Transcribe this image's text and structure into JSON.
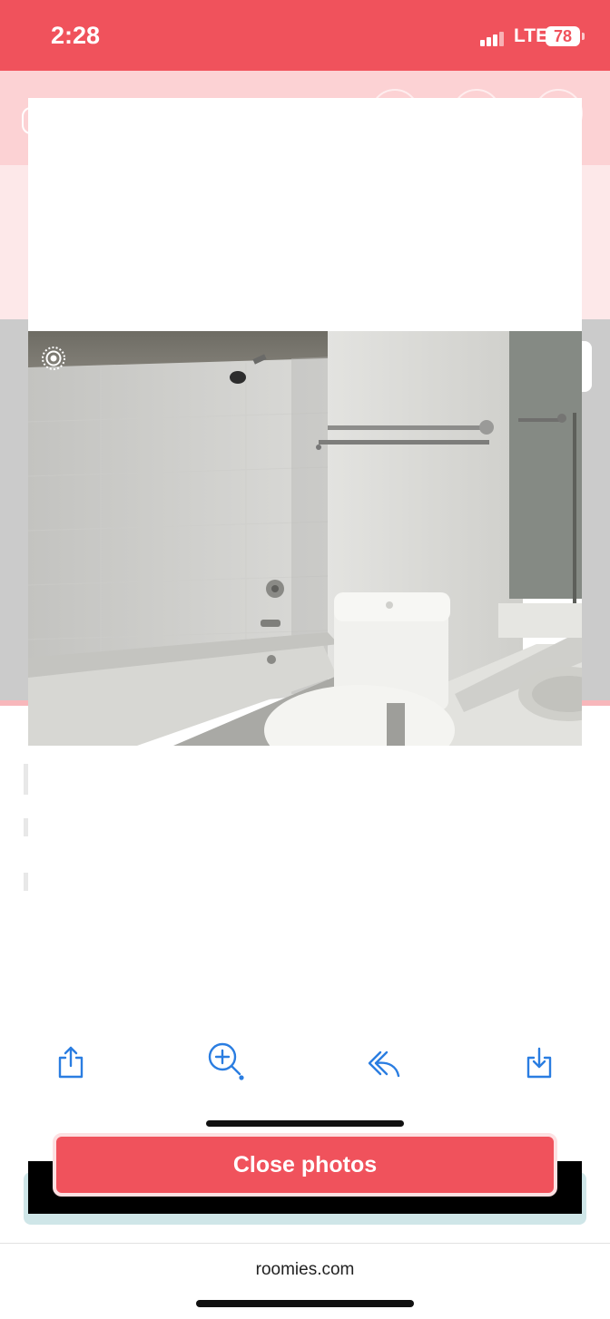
{
  "status_bar": {
    "time": "2:28",
    "network": "LTE",
    "battery": "78",
    "color": "#f0525c"
  },
  "photo_viewer": {
    "photo_alt": "Bathroom with white bathtub, shower head, toilet, towel bar and vanity sink",
    "live_indicator_icon": "live-photo-icon"
  },
  "toolbar": {
    "icons": [
      "share-icon",
      "zoom-in-icon",
      "reply-icon",
      "download-icon"
    ],
    "accent": "#2a7de1"
  },
  "close_button": {
    "label": "Close photos",
    "color": "#f0525c"
  },
  "footer": {
    "domain": "roomies.com"
  }
}
